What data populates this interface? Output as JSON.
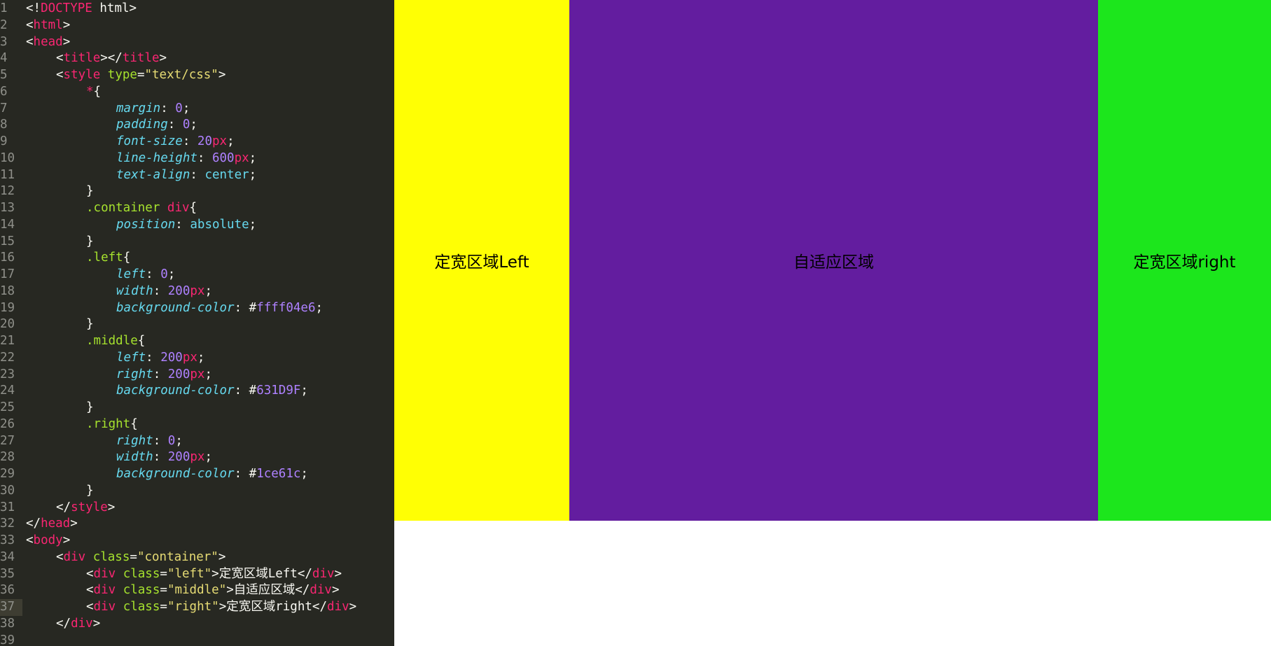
{
  "editor": {
    "lines": [
      {
        "n": "1",
        "ind": 0,
        "t": [
          [
            "p",
            "<!"
          ],
          [
            "tag",
            "DOCTYPE"
          ],
          [
            "p",
            " html>"
          ]
        ]
      },
      {
        "n": "2",
        "ind": 0,
        "t": [
          [
            "p",
            "<"
          ],
          [
            "tag",
            "html"
          ],
          [
            "p",
            ">"
          ]
        ]
      },
      {
        "n": "3",
        "ind": 0,
        "t": [
          [
            "p",
            "<"
          ],
          [
            "tag",
            "head"
          ],
          [
            "p",
            ">"
          ]
        ]
      },
      {
        "n": "4",
        "ind": 1,
        "t": [
          [
            "p",
            "<"
          ],
          [
            "tag",
            "title"
          ],
          [
            "p",
            "></"
          ],
          [
            "tag",
            "title"
          ],
          [
            "p",
            ">"
          ]
        ]
      },
      {
        "n": "5",
        "ind": 1,
        "t": [
          [
            "p",
            "<"
          ],
          [
            "tag",
            "style"
          ],
          [
            "p",
            " "
          ],
          [
            "attr",
            "type"
          ],
          [
            "p",
            "="
          ],
          [
            "str",
            "\"text/css\""
          ],
          [
            "p",
            ">"
          ]
        ]
      },
      {
        "n": "6",
        "ind": 2,
        "t": [
          [
            "tag",
            "*"
          ],
          [
            "p",
            "{"
          ]
        ]
      },
      {
        "n": "7",
        "ind": 3,
        "t": [
          [
            "prop",
            "margin"
          ],
          [
            "p",
            ": "
          ],
          [
            "num",
            "0"
          ],
          [
            "p",
            ";"
          ]
        ]
      },
      {
        "n": "8",
        "ind": 3,
        "t": [
          [
            "prop",
            "padding"
          ],
          [
            "p",
            ": "
          ],
          [
            "num",
            "0"
          ],
          [
            "p",
            ";"
          ]
        ]
      },
      {
        "n": "9",
        "ind": 3,
        "t": [
          [
            "prop",
            "font-size"
          ],
          [
            "p",
            ": "
          ],
          [
            "num",
            "20"
          ],
          [
            "unit",
            "px"
          ],
          [
            "p",
            ";"
          ]
        ]
      },
      {
        "n": "10",
        "ind": 3,
        "t": [
          [
            "prop",
            "line-height"
          ],
          [
            "p",
            ": "
          ],
          [
            "num",
            "600"
          ],
          [
            "unit",
            "px"
          ],
          [
            "p",
            ";"
          ]
        ]
      },
      {
        "n": "11",
        "ind": 3,
        "t": [
          [
            "prop",
            "text-align"
          ],
          [
            "p",
            ": "
          ],
          [
            "val",
            "center"
          ],
          [
            "p",
            ";"
          ]
        ]
      },
      {
        "n": "12",
        "ind": 2,
        "t": [
          [
            "p",
            "}"
          ]
        ]
      },
      {
        "n": "13",
        "ind": 2,
        "t": [
          [
            "sel",
            ".container "
          ],
          [
            "tag",
            "div"
          ],
          [
            "p",
            "{"
          ]
        ]
      },
      {
        "n": "14",
        "ind": 3,
        "t": [
          [
            "prop",
            "position"
          ],
          [
            "p",
            ": "
          ],
          [
            "val",
            "absolute"
          ],
          [
            "p",
            ";"
          ]
        ]
      },
      {
        "n": "15",
        "ind": 2,
        "t": [
          [
            "p",
            "}"
          ]
        ]
      },
      {
        "n": "16",
        "ind": 2,
        "t": [
          [
            "sel",
            ".left"
          ],
          [
            "p",
            "{"
          ]
        ]
      },
      {
        "n": "17",
        "ind": 3,
        "t": [
          [
            "prop",
            "left"
          ],
          [
            "p",
            ": "
          ],
          [
            "num",
            "0"
          ],
          [
            "p",
            ";"
          ]
        ]
      },
      {
        "n": "18",
        "ind": 3,
        "t": [
          [
            "prop",
            "width"
          ],
          [
            "p",
            ": "
          ],
          [
            "num",
            "200"
          ],
          [
            "unit",
            "px"
          ],
          [
            "p",
            ";"
          ]
        ]
      },
      {
        "n": "19",
        "ind": 3,
        "t": [
          [
            "prop",
            "background-color"
          ],
          [
            "p",
            ": #"
          ],
          [
            "hex",
            "ffff04e6"
          ],
          [
            "p",
            ";"
          ]
        ]
      },
      {
        "n": "20",
        "ind": 2,
        "t": [
          [
            "p",
            "}"
          ]
        ]
      },
      {
        "n": "21",
        "ind": 2,
        "t": [
          [
            "sel",
            ".middle"
          ],
          [
            "p",
            "{"
          ]
        ]
      },
      {
        "n": "22",
        "ind": 3,
        "t": [
          [
            "prop",
            "left"
          ],
          [
            "p",
            ": "
          ],
          [
            "num",
            "200"
          ],
          [
            "unit",
            "px"
          ],
          [
            "p",
            ";"
          ]
        ]
      },
      {
        "n": "23",
        "ind": 3,
        "t": [
          [
            "prop",
            "right"
          ],
          [
            "p",
            ": "
          ],
          [
            "num",
            "200"
          ],
          [
            "unit",
            "px"
          ],
          [
            "p",
            ";"
          ]
        ]
      },
      {
        "n": "24",
        "ind": 3,
        "t": [
          [
            "prop",
            "background-color"
          ],
          [
            "p",
            ": #"
          ],
          [
            "hex",
            "631D9F"
          ],
          [
            "p",
            ";"
          ]
        ]
      },
      {
        "n": "25",
        "ind": 2,
        "t": [
          [
            "p",
            "}"
          ]
        ]
      },
      {
        "n": "26",
        "ind": 2,
        "t": [
          [
            "sel",
            ".right"
          ],
          [
            "p",
            "{"
          ]
        ]
      },
      {
        "n": "27",
        "ind": 3,
        "t": [
          [
            "prop",
            "right"
          ],
          [
            "p",
            ": "
          ],
          [
            "num",
            "0"
          ],
          [
            "p",
            ";"
          ]
        ]
      },
      {
        "n": "28",
        "ind": 3,
        "t": [
          [
            "prop",
            "width"
          ],
          [
            "p",
            ": "
          ],
          [
            "num",
            "200"
          ],
          [
            "unit",
            "px"
          ],
          [
            "p",
            ";"
          ]
        ]
      },
      {
        "n": "29",
        "ind": 3,
        "t": [
          [
            "prop",
            "background-color"
          ],
          [
            "p",
            ": #"
          ],
          [
            "hex",
            "1ce61c"
          ],
          [
            "p",
            ";"
          ]
        ]
      },
      {
        "n": "30",
        "ind": 2,
        "t": [
          [
            "p",
            "}"
          ]
        ]
      },
      {
        "n": "31",
        "ind": 1,
        "t": [
          [
            "p",
            "</"
          ],
          [
            "tag",
            "style"
          ],
          [
            "p",
            ">"
          ]
        ]
      },
      {
        "n": "32",
        "ind": 0,
        "t": [
          [
            "p",
            "</"
          ],
          [
            "tag",
            "head"
          ],
          [
            "p",
            ">"
          ]
        ]
      },
      {
        "n": "33",
        "ind": 0,
        "t": [
          [
            "p",
            "<"
          ],
          [
            "tag",
            "body"
          ],
          [
            "p",
            ">"
          ]
        ]
      },
      {
        "n": "34",
        "ind": 1,
        "t": [
          [
            "p",
            "<"
          ],
          [
            "tag",
            "div"
          ],
          [
            "p",
            " "
          ],
          [
            "attr",
            "class"
          ],
          [
            "p",
            "="
          ],
          [
            "str",
            "\"container\""
          ],
          [
            "p",
            ">"
          ]
        ]
      },
      {
        "n": "35",
        "ind": 2,
        "t": [
          [
            "p",
            "<"
          ],
          [
            "tag",
            "div"
          ],
          [
            "p",
            " "
          ],
          [
            "attr",
            "class"
          ],
          [
            "p",
            "="
          ],
          [
            "str",
            "\"left\""
          ],
          [
            "p",
            ">定宽区域Left</"
          ],
          [
            "tag",
            "div"
          ],
          [
            "p",
            ">"
          ]
        ]
      },
      {
        "n": "36",
        "ind": 2,
        "t": [
          [
            "p",
            "<"
          ],
          [
            "tag",
            "div"
          ],
          [
            "p",
            " "
          ],
          [
            "attr",
            "class"
          ],
          [
            "p",
            "="
          ],
          [
            "str",
            "\"middle\""
          ],
          [
            "p",
            ">自适应区域</"
          ],
          [
            "tag",
            "div"
          ],
          [
            "p",
            ">"
          ]
        ]
      },
      {
        "n": "37",
        "ind": 2,
        "current": true,
        "t": [
          [
            "p",
            "<"
          ],
          [
            "tag",
            "div"
          ],
          [
            "p",
            " "
          ],
          [
            "attr",
            "class"
          ],
          [
            "p",
            "="
          ],
          [
            "str",
            "\"right\""
          ],
          [
            "p",
            ">定宽区域right</"
          ],
          [
            "tag",
            "div"
          ],
          [
            "p",
            ">"
          ]
        ]
      },
      {
        "n": "38",
        "ind": 1,
        "t": [
          [
            "p",
            "</"
          ],
          [
            "tag",
            "div"
          ],
          [
            "p",
            ">"
          ]
        ]
      },
      {
        "n": "39",
        "ind": 0,
        "t": []
      }
    ]
  },
  "preview": {
    "left": {
      "label": "定宽区域Left",
      "color": "#ffff04"
    },
    "middle": {
      "label": "自适应区域",
      "color": "#631d9f"
    },
    "right": {
      "label": "定宽区域right",
      "color": "#1ce61c"
    }
  }
}
